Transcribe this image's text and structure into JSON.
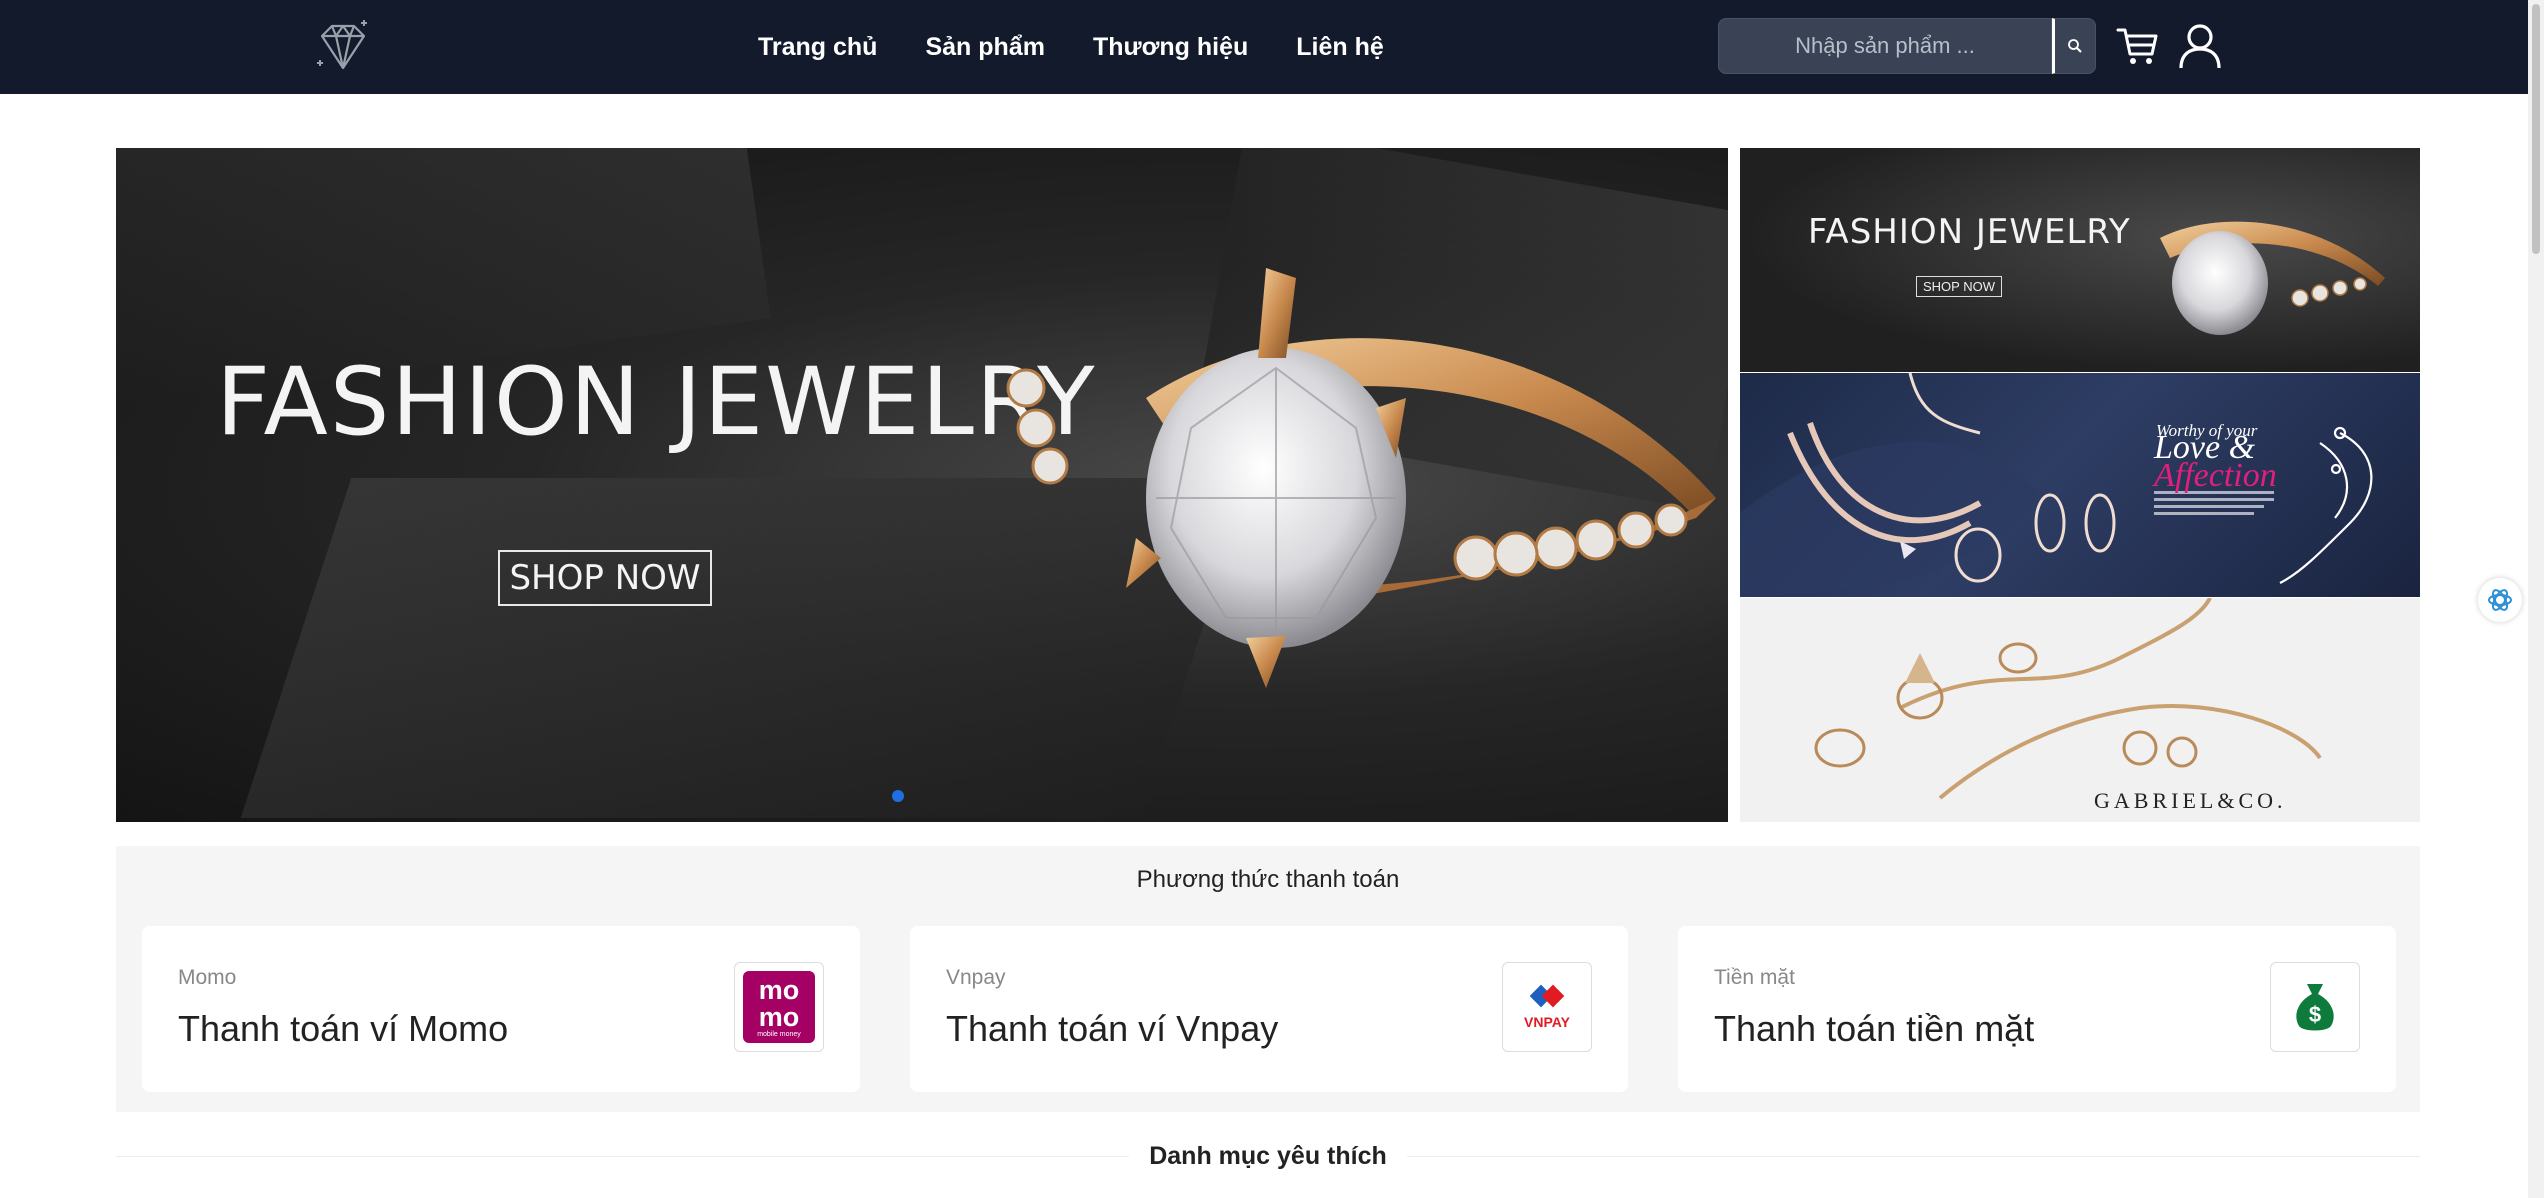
{
  "header": {
    "nav": [
      {
        "label": "Trang chủ"
      },
      {
        "label": "Sản phẩm"
      },
      {
        "label": "Thương hiệu"
      },
      {
        "label": "Liên hệ"
      }
    ],
    "search": {
      "placeholder": "Nhập sản phẩm ..."
    },
    "icons": {
      "logo": "diamond-logo",
      "search": "search-icon",
      "cart": "cart-icon",
      "user": "user-icon"
    },
    "background": "#121a2b"
  },
  "carousel": {
    "title": "FASHION JEWELRY",
    "cta": "SHOP NOW",
    "active_slide": 1,
    "dot_color": "#1f6fe0"
  },
  "side_banners": [
    {
      "title": "FASHION JEWELRY",
      "cta": "SHOP NOW"
    },
    {
      "small": "Worthy of your",
      "love": "Love &",
      "affection": "Affection"
    },
    {
      "brand": "GABRIEL&CO."
    }
  ],
  "payment": {
    "title": "Phương thức thanh toán",
    "methods": [
      {
        "label": "Momo",
        "desc": "Thanh toán ví Momo",
        "logo_top": "mo",
        "logo_bottom": "mo",
        "logo_sub": "mobile money",
        "color": "#a50064"
      },
      {
        "label": "Vnpay",
        "desc": "Thanh toán ví Vnpay",
        "logo_text": "VNPAY",
        "color": "#e21b22"
      },
      {
        "label": "Tiền mặt",
        "desc": "Thanh toán tiền mặt",
        "icon": "money-bag-icon",
        "color": "#0e7a3c"
      }
    ]
  },
  "favorites": {
    "title": "Danh mục yêu thích"
  },
  "float_icon": "chatbot-icon"
}
